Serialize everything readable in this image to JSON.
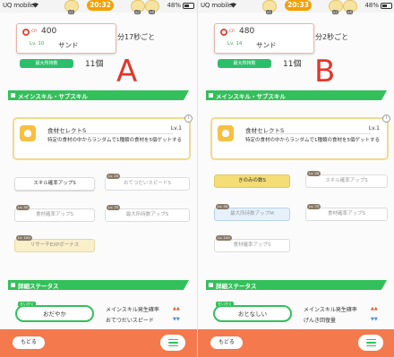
{
  "panels": [
    {
      "id": "a",
      "status": {
        "carrier": "UQ mobile",
        "time": "20:32",
        "battery": "48%",
        "overlay_badges": [
          "x1",
          "x2",
          "x4"
        ]
      },
      "header": {
        "cp_label": "CP",
        "cp_value": "400",
        "level": "Lv. 10",
        "name": "サンド",
        "help_interval": "分17秒ごと",
        "carry_tag": "最大所持数",
        "carry_count": "11個",
        "variant_letter": "A"
      },
      "skills_section_title": "メインスキル・サブスキル",
      "main_skill": {
        "name": "食材セレクトS",
        "level": "Lv.1",
        "description": "特定の食材の中からランダムで1種類の食材を5個ゲットする"
      },
      "sub_skills": [
        {
          "label": "スキル確率アップS",
          "lv": ""
        },
        {
          "label": "おてつだいスピードS",
          "lv": "Lv. 25"
        },
        {
          "label": "食材確率アップS",
          "lv": "Lv. 50"
        },
        {
          "label": "最大所持数アップS",
          "lv": "Lv. 75"
        },
        {
          "label": "リサーチEXPボーナス",
          "lv": "Lv. 100"
        }
      ],
      "details_section_title": "詳細ステータス",
      "nature": {
        "label": "せいかく",
        "value": "おだやか"
      },
      "stats": [
        "メインスキル発生確率",
        "おてつだいスピード"
      ],
      "bottom": {
        "back": "もどる"
      }
    },
    {
      "id": "b",
      "status": {
        "carrier": "UQ mobile",
        "time": "20:33",
        "battery": "48%",
        "overlay_badges": [
          "x1",
          "x2",
          "x4"
        ]
      },
      "header": {
        "cp_label": "CP",
        "cp_value": "480",
        "level": "Lv. 14",
        "name": "サンド",
        "help_interval": "分2秒ごと",
        "carry_tag": "最大所持数",
        "carry_count": "11個",
        "variant_letter": "B"
      },
      "skills_section_title": "メインスキル・サブスキル",
      "main_skill": {
        "name": "食材セレクトS",
        "level": "Lv.1",
        "description": "特定の食材の中からランダムで1種類の食材を5個ゲットする"
      },
      "sub_skills": [
        {
          "label": "きのみの数S",
          "lv": ""
        },
        {
          "label": "スキル確率アップS",
          "lv": "Lv. 25"
        },
        {
          "label": "最大所持数アップM",
          "lv": "Lv. 50"
        },
        {
          "label": "食材確率アップS",
          "lv": "Lv. 75"
        },
        {
          "label": "食材確率アップS",
          "lv": "Lv. 100"
        }
      ],
      "details_section_title": "詳細ステータス",
      "nature": {
        "label": "せいかく",
        "value": "おとなしい"
      },
      "stats": [
        "メインスキル発生確率",
        "げんき回復量"
      ],
      "bottom": {
        "back": "もどる"
      }
    }
  ],
  "colors": {
    "green": "#33c05a",
    "orange": "#f4794d",
    "red_letter": "#e3362c",
    "gold": "#f3d98a"
  }
}
